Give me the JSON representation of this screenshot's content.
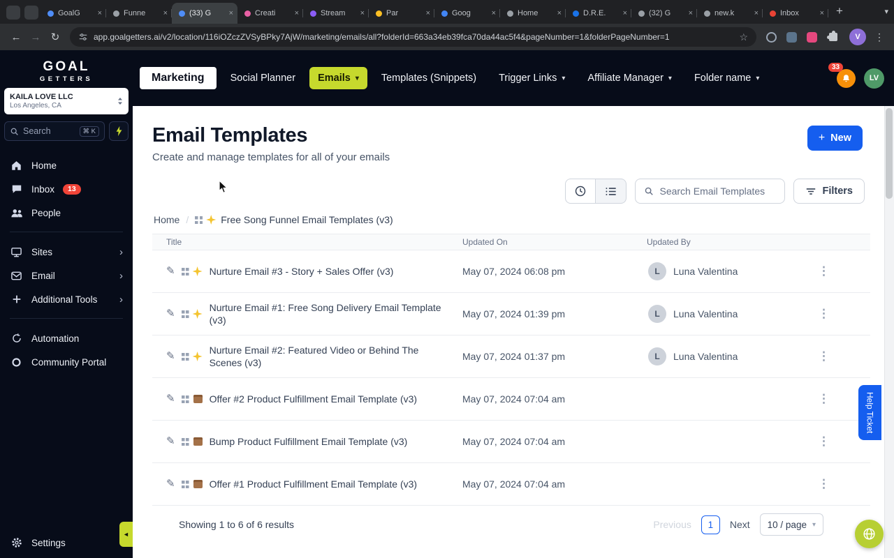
{
  "glyphs": {
    "kebab": "⋮",
    "close": "×",
    "caret_down": "▾",
    "chevron_right": "›",
    "pencil": "✎",
    "star": "☆",
    "back": "←",
    "forward": "→",
    "reload": "↻",
    "collapse": "◄",
    "plus": "+",
    "new_tab": "+"
  },
  "colors": {
    "accent_lime": "#c6d92d",
    "primary_blue": "#155eef",
    "badge_red": "#f04438",
    "bell_orange": "#f79009",
    "avatar_green": "#4f9a68",
    "dark_bg": "#070c19"
  },
  "browser": {
    "tabs": [
      {
        "label": "GoalG",
        "favicon": "#4f8df7",
        "active": false
      },
      {
        "label": "Funne",
        "favicon": "#9aa0a6",
        "active": false
      },
      {
        "label": "(33) G",
        "favicon": "#4f8df7",
        "active": true
      },
      {
        "label": "Creati",
        "favicon": "#e860a4",
        "active": false
      },
      {
        "label": "Stream",
        "favicon": "#8b5cf6",
        "active": false
      },
      {
        "label": "Par",
        "favicon": "#fbbf24",
        "active": false
      },
      {
        "label": "Goog",
        "favicon": "#4285f4",
        "active": false
      },
      {
        "label": "Home",
        "favicon": "#9aa0a6",
        "active": false
      },
      {
        "label": "D.R.E.",
        "favicon": "#1a73e8",
        "active": false
      },
      {
        "label": "(32) G",
        "favicon": "#9aa0a6",
        "active": false
      },
      {
        "label": "new.k",
        "favicon": "#9aa0a6",
        "active": false
      },
      {
        "label": "Inbox",
        "favicon": "#ea4335",
        "active": false
      }
    ],
    "url": "app.goalgetters.ai/v2/location/116iOZczZVSyBPky7AjW/marketing/emails/all?folderId=663a34eb39fca70da44ac5f4&pageNumber=1&folderPageNumber=1",
    "profile_initial": "V"
  },
  "sidebar": {
    "logo_line1": "GOAL",
    "logo_line2": "GETTERS",
    "account": {
      "name": "KAILA LOVE LLC",
      "location": "Los Angeles, CA"
    },
    "search": {
      "placeholder": "Search",
      "shortcut": "⌘ K"
    },
    "items": [
      {
        "label": "Home"
      },
      {
        "label": "Inbox",
        "badge": "13"
      },
      {
        "label": "People"
      },
      {
        "label": "Sites"
      },
      {
        "label": "Email"
      },
      {
        "label": "Additional Tools"
      },
      {
        "label": "Automation"
      },
      {
        "label": "Community Portal"
      }
    ],
    "settings_label": "Settings"
  },
  "header": {
    "nav": [
      {
        "label": "Marketing",
        "style": "selected"
      },
      {
        "label": "Social Planner"
      },
      {
        "label": "Emails",
        "style": "pill",
        "caret": true
      },
      {
        "label": "Templates (Snippets)"
      },
      {
        "label": "Trigger Links",
        "caret": true
      },
      {
        "label": "Affiliate Manager",
        "caret": true
      },
      {
        "label": "Folder name",
        "caret": true
      }
    ],
    "notification_count": "33",
    "avatar_initials": "LV"
  },
  "main": {
    "title": "Email Templates",
    "subtitle": "Create and manage templates for all of your emails",
    "new_button": "New",
    "search_placeholder": "Search Email Templates",
    "filters_label": "Filters",
    "breadcrumb": {
      "home": "Home",
      "separator": "/",
      "current": "Free Song Funnel Email Templates (v3)"
    },
    "table": {
      "columns": [
        "Title",
        "Updated On",
        "Updated By"
      ],
      "rows": [
        {
          "icon": "sparkle",
          "title": "Nurture Email #3 - Story + Sales Offer (v3)",
          "updated": "May 07, 2024 06:08 pm",
          "by": "Luna Valentina",
          "by_initial": "L"
        },
        {
          "icon": "sparkle",
          "title": "Nurture Email #1: Free Song Delivery Email Template (v3)",
          "updated": "May 07, 2024 01:39 pm",
          "by": "Luna Valentina",
          "by_initial": "L"
        },
        {
          "icon": "sparkle",
          "title": "Nurture Email #2: Featured Video or Behind The Scenes (v3)",
          "updated": "May 07, 2024 01:37 pm",
          "by": "Luna Valentina",
          "by_initial": "L"
        },
        {
          "icon": "package",
          "title": "Offer #2 Product Fulfillment Email Template (v3)",
          "updated": "May 07, 2024 07:04 am",
          "by": "",
          "by_initial": ""
        },
        {
          "icon": "package",
          "title": "Bump Product Fulfillment Email Template (v3)",
          "updated": "May 07, 2024 07:04 am",
          "by": "",
          "by_initial": ""
        },
        {
          "icon": "package",
          "title": "Offer #1 Product Fulfillment Email Template (v3)",
          "updated": "May 07, 2024 07:04 am",
          "by": "",
          "by_initial": ""
        }
      ]
    },
    "footer": {
      "summary": "Showing 1 to 6 of 6 results",
      "previous": "Previous",
      "page": "1",
      "next": "Next",
      "page_size": "10 / page"
    }
  },
  "help_ticket_label": "Help Ticket"
}
